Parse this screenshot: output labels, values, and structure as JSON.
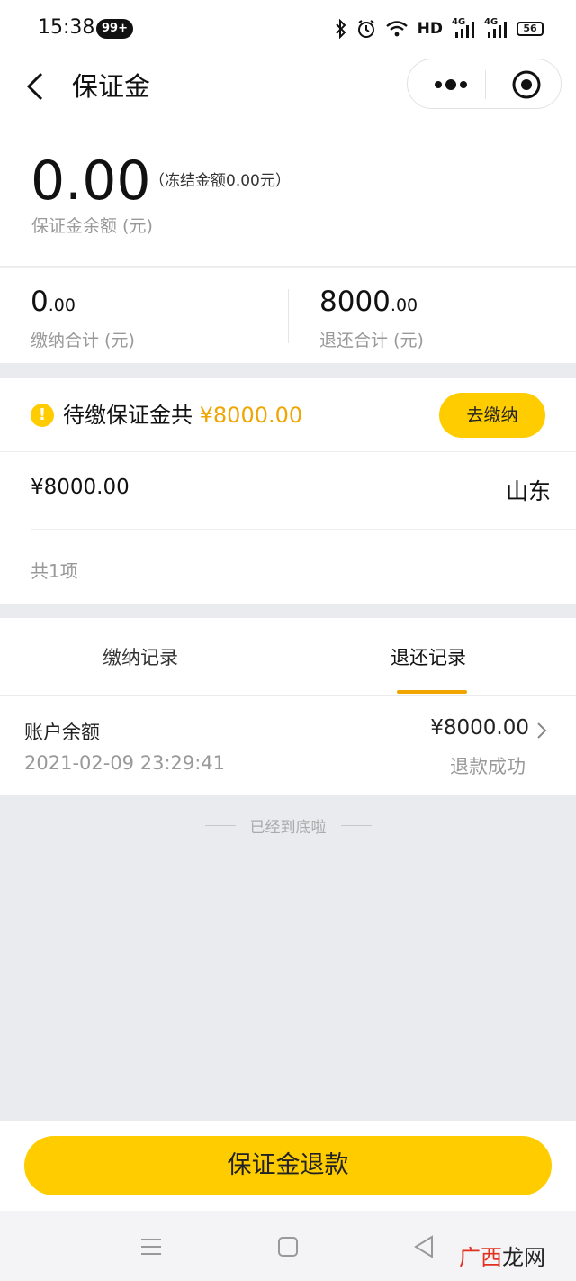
{
  "status_bar": {
    "time": "15:38",
    "notification_count": "99+",
    "hd_label": "HD",
    "signal1": "4G",
    "signal2": "4G",
    "battery": "56"
  },
  "nav": {
    "title": "保证金"
  },
  "balance": {
    "amount": "0.00",
    "frozen_text": "（冻结金额0.00元）",
    "label": "保证金余额 (元)"
  },
  "totals": {
    "paid_int": "0",
    "paid_dec": ".00",
    "paid_label": "缴纳合计 (元)",
    "refunded_int": "8000",
    "refunded_dec": ".00",
    "refunded_label": "退还合计 (元)"
  },
  "pending": {
    "text": "待缴保证金共",
    "amount": "¥8000.00",
    "pay_button": "去缴纳",
    "item_amount": "¥8000.00",
    "item_region": "山东",
    "count_text": "共1项"
  },
  "tabs": {
    "items": [
      "缴纳记录",
      "退还记录"
    ],
    "active_index": 1
  },
  "record": {
    "title": "账户余额",
    "datetime": "2021-02-09 23:29:41",
    "amount": "¥8000.00",
    "status": "退款成功"
  },
  "end_text": "已经到底啦",
  "refund_button": "保证金退款",
  "watermark": {
    "accent": "广西",
    "rest": "龙网"
  },
  "colors": {
    "accent_yellow": "#ffcc00",
    "accent_orange": "#f0a500",
    "background": "#e9ebef"
  }
}
